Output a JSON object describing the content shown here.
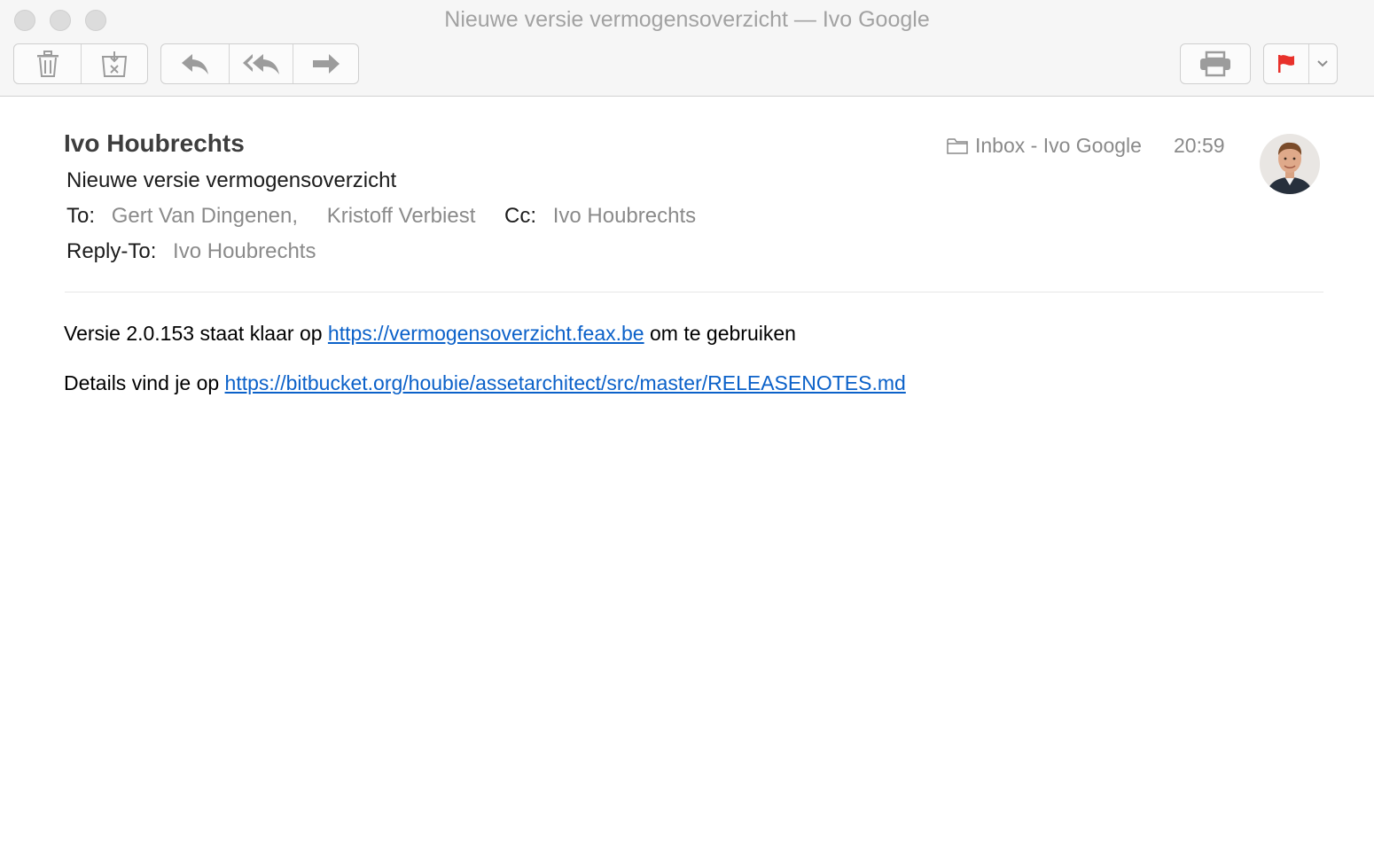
{
  "window": {
    "title": "Nieuwe versie vermogensoverzicht — Ivo Google"
  },
  "toolbar": {
    "buttons": [
      "trash-icon",
      "junk-icon",
      "reply-icon",
      "reply-all-icon",
      "forward-icon",
      "print-icon",
      "flag-icon",
      "chevron-down-icon"
    ],
    "flag_color": "#e8312b"
  },
  "message": {
    "from": "Ivo Houbrechts",
    "subject": "Nieuwe versie vermogensoverzicht",
    "to_label": "To:",
    "to": [
      "Gert Van Dingenen,",
      "Kristoff Verbiest"
    ],
    "cc_label": "Cc:",
    "cc": "Ivo Houbrechts",
    "reply_to_label": "Reply-To:",
    "reply_to": "Ivo Houbrechts",
    "mailbox": "Inbox - Ivo Google",
    "time": "20:59"
  },
  "body": {
    "line1_prefix": "Versie 2.0.153 staat klaar op ",
    "line1_link": "https://vermogensoverzicht.feax.be",
    "line1_suffix": " om te gebruiken",
    "line2_prefix": "Details vind je op ",
    "line2_link": "https://bitbucket.org/houbie/assetarchitect/src/master/RELEASENOTES.md"
  },
  "colors": {
    "link": "#0b61c9",
    "muted": "#8a8a8a"
  }
}
